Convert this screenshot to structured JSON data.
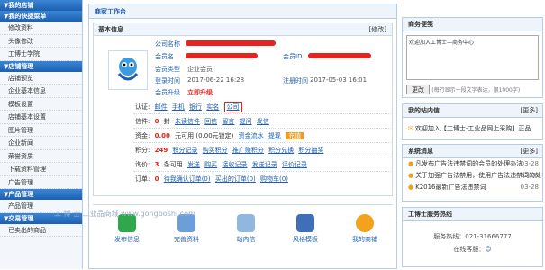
{
  "sidebar": {
    "section1": "▼我的店铺",
    "section2": "▼我的快捷菜单",
    "quick": [
      "修改资料",
      "头像修改",
      "工博士学院"
    ],
    "section3": "▼店铺管理",
    "shop": [
      "店铺预览",
      "企业基本信息",
      "模板设置",
      "店铺基本设置",
      "图片管理",
      "企业新闻",
      "荣誉资质",
      "下载资料管理",
      "广告管理"
    ],
    "section4": "▼产品管理",
    "product": [
      "产品管理"
    ],
    "section5": "▼交易管理",
    "trade": [
      "已卖出的商品"
    ]
  },
  "main": {
    "title": "商家工作台",
    "basic_title": "基本信息",
    "edit": "[修改]",
    "labels": {
      "company": "公司名称",
      "member": "会员名",
      "member_type": "会员类型",
      "login_time": "登录时间",
      "upgrade": "会员升级",
      "member_id": "会员ID",
      "reg_time": "注册时间"
    },
    "values": {
      "member_type": "企业会员",
      "login_time": "2017-06-22 16:28",
      "upgrade": "立即升级",
      "reg_time": "2017-05-03 16:01"
    },
    "cert_label": "认证:",
    "cert": [
      "邮件",
      "手机",
      "银行",
      "实名",
      "公司"
    ],
    "msg": {
      "label": "信件:",
      "count": "0",
      "unit": "封",
      "items": [
        "未读信件",
        "回信",
        "留言",
        "提问",
        "发信"
      ]
    },
    "money": {
      "label": "资金:",
      "amount": "0.00",
      "unit": "元可用 (0.00元锁定)",
      "items": [
        "资金流水",
        "提现"
      ],
      "btn": "充值"
    },
    "points": {
      "label": "积分:",
      "count": "249",
      "items": [
        "积分记录",
        "购买积分",
        "推广赚积分",
        "积分兑换",
        "积分抽奖"
      ]
    },
    "quote": {
      "label": "询价:",
      "count": "3",
      "unit": "条可用",
      "items": [
        "发送",
        "购买",
        "接收记录",
        "发送记录",
        "评价记录"
      ]
    },
    "order": {
      "label": "订单:",
      "count": "0",
      "items": [
        "待我确认订单(0)",
        "买出的订单(0)",
        "购物车(0)"
      ]
    },
    "shortcuts": [
      "发布信息",
      "完善资料",
      "站内信",
      "风格模板",
      "我的商铺"
    ]
  },
  "notes": {
    "title": "商务便笺",
    "text": "欢迎加入工博士—商务中心",
    "save": "更改",
    "hint": "(每行显示一段文字表达，限1000字)"
  },
  "station": {
    "title": "我的站内信",
    "more": "[更多]",
    "items": [
      "欢迎加入【工博士-工业品网上采购】正品"
    ]
  },
  "system": {
    "title": "系统消息",
    "more": "[更多]",
    "items": [
      {
        "text": "凡发布广告法违禁词的会员的处理办法",
        "date": "03-28"
      },
      {
        "text": "关于加强广告法禁用，使用广告法违禁词的处罚",
        "date": "03-28"
      },
      {
        "text": "K2016最新广告法违禁词",
        "date": "03-28"
      }
    ]
  },
  "hotline": {
    "title": "工博士服务热线",
    "phone": "服务热线：021-31666777",
    "online": "在线客服："
  },
  "watermark": "工 博 士  工业品商城 www.gongboshi.com"
}
